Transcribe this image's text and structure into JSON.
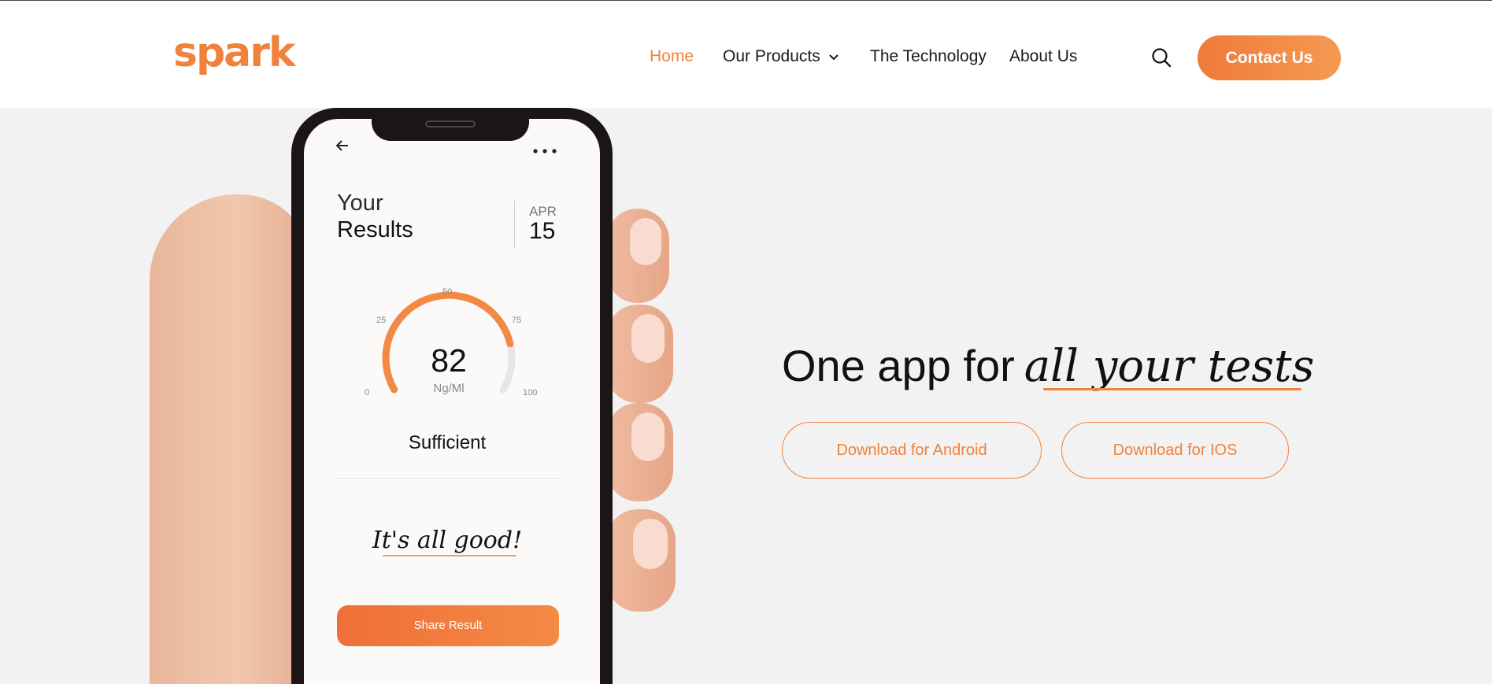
{
  "header": {
    "logo": "spark",
    "nav": [
      {
        "label": "Home",
        "active": true
      },
      {
        "label": "Our Products",
        "has_dropdown": true
      },
      {
        "label": "The Technology"
      },
      {
        "label": "About Us"
      }
    ],
    "search_icon": "search-icon",
    "contact_label": "Contact Us"
  },
  "phone": {
    "title_line1": "Your",
    "title_line2": "Results",
    "date_month": "APR",
    "date_day": "15",
    "gauge_ticks": [
      "0",
      "25",
      "50",
      "75",
      "100"
    ],
    "score": "82",
    "unit": "Ng/Ml",
    "status": "Sufficient",
    "message": "It's all good!",
    "share_label": "Share Result",
    "gauge_value": 82
  },
  "hero": {
    "title_plain": "One app for",
    "title_script": "all your tests",
    "android_label": "Download for Android",
    "ios_label": "Download for IOS"
  },
  "colors": {
    "accent": "#f0823c",
    "background": "#f2f2f2",
    "header_bg": "#ffffff"
  }
}
